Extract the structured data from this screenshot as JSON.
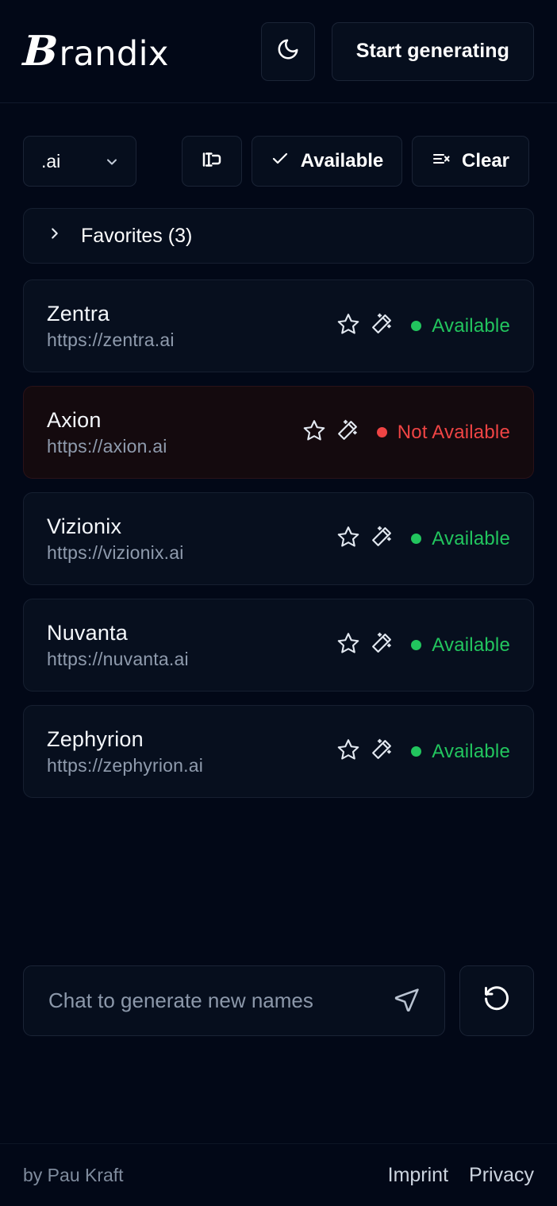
{
  "header": {
    "logo_initial": "B",
    "logo_rest": "randix",
    "theme_toggle_icon": "moon-icon",
    "start_button_label": "Start generating"
  },
  "filters": {
    "domain_value": ".ai",
    "domain_chevron_icon": "chevron-down-icon",
    "length_icon": "text-width-icon",
    "available_icon": "check-icon",
    "available_label": "Available",
    "clear_icon": "list-x-icon",
    "clear_label": "Clear"
  },
  "favorites": {
    "chevron_icon": "chevron-right-icon",
    "label": "Favorites (3)"
  },
  "results": {
    "star_icon": "star-icon",
    "wand_icon": "magic-wand-icon",
    "items": [
      {
        "name": "Zentra",
        "url": "https://zentra.ai",
        "status": "Available",
        "available": true
      },
      {
        "name": "Axion",
        "url": "https://axion.ai",
        "status": "Not Available",
        "available": false
      },
      {
        "name": "Vizionix",
        "url": "https://vizionix.ai",
        "status": "Available",
        "available": true
      },
      {
        "name": "Nuvanta",
        "url": "https://nuvanta.ai",
        "status": "Available",
        "available": true
      },
      {
        "name": "Zephyrion",
        "url": "https://zephyrion.ai",
        "status": "Available",
        "available": true
      }
    ]
  },
  "chat": {
    "placeholder": "Chat to generate new names",
    "value": "",
    "send_icon": "send-icon",
    "reset_icon": "rotate-ccw-icon"
  },
  "footer": {
    "credit": "by Pau Kraft",
    "links": [
      "Imprint",
      "Privacy"
    ]
  },
  "colors": {
    "background": "#020817",
    "card": "#070f1e",
    "card_unavailable": "#140a0e",
    "border": "#1b2436",
    "available": "#22c55e",
    "not_available": "#ef4444",
    "text": "#ffffff",
    "muted": "#8f9bad"
  }
}
